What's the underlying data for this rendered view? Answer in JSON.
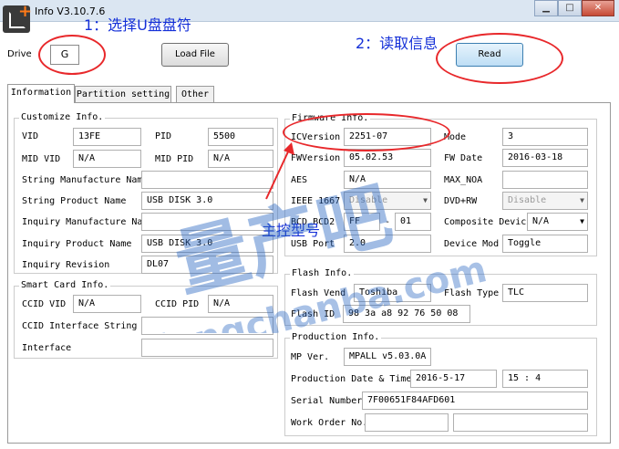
{
  "window": {
    "title": "Info V3.10.7.6"
  },
  "annotations": {
    "step1": "1：选择U盘盘符",
    "step2": "2：读取信息",
    "controller": "主控型号"
  },
  "top": {
    "drive_label": "Drive",
    "drive_value": "G",
    "load_button": "Load File",
    "read_button": "Read"
  },
  "tabs": [
    "Information",
    "Partition setting",
    "Other"
  ],
  "customize": {
    "title": "Customize Info.",
    "vid_label": "VID",
    "vid": "13FE",
    "pid_label": "PID",
    "pid": "5500",
    "mid_vid_label": "MID VID",
    "mid_vid": "N/A",
    "mid_pid_label": "MID PID",
    "mid_pid": "N/A",
    "string_mfr_label": "String Manufacture Nam",
    "string_mfr": "",
    "string_product_label": "String Product Name",
    "string_product": "USB DISK 3.0",
    "inquiry_mfr_label": "Inquiry Manufacture Nam",
    "inquiry_mfr": "",
    "inquiry_product_label": "Inquiry Product Name",
    "inquiry_product": "USB DISK 3.0",
    "inquiry_rev_label": "Inquiry Revision",
    "inquiry_rev": "DL07"
  },
  "smartcard": {
    "title": "Smart Card Info.",
    "ccid_vid_label": "CCID VID",
    "ccid_vid": "N/A",
    "ccid_pid_label": "CCID PID",
    "ccid_pid": "N/A",
    "ccid_iface_string_label": "CCID Interface String",
    "ccid_iface_string": "",
    "interface_label": "Interface",
    "interface": ""
  },
  "firmware": {
    "title": "Firmware Info.",
    "ic_version_label": "ICVersion",
    "ic_version": "2251-07",
    "mode_label": "Mode",
    "mode": "3",
    "fw_version_label": "FWVersion",
    "fw_version": "05.02.53",
    "fw_date_label": "FW Date",
    "fw_date": "2016-03-18",
    "aes_label": "AES",
    "aes": "N/A",
    "max_noa_label": "MAX_NOA",
    "max_noa": "",
    "ieee_label": "IEEE 1667",
    "ieee": "Disable",
    "dvdrw_label": "DVD+RW",
    "dvdrw": "Disable",
    "bcd_label": "BCD   BCD2",
    "bcd": "FF",
    "bcd2": "01",
    "composite_label": "Composite Devic",
    "composite": "N/A",
    "usb_port_label": "USB Port",
    "usb_port": "2.0",
    "device_mode_label": "Device Mod",
    "device_mode": "Toggle"
  },
  "flash": {
    "title": "Flash Info.",
    "vendor_label": "Flash Vend",
    "vendor": "Toshiba",
    "type_label": "Flash Type",
    "type": "TLC",
    "id_label": "Flash ID",
    "id": "98 3a a8 92 76 50 08"
  },
  "production": {
    "title": "Production Info.",
    "mp_ver_label": "MP Ver.",
    "mp_ver": "MPALL v5.03.0A",
    "date_label": "Production Date & Time",
    "date": "2016-5-17",
    "time": "15 : 4",
    "serial_label": "Serial Number",
    "serial": "7F00651F84AFD601",
    "work_order_label": "Work Order No.",
    "work_order": ""
  },
  "watermark": {
    "main": "量产吧",
    "domain": "liangchanba.com"
  }
}
